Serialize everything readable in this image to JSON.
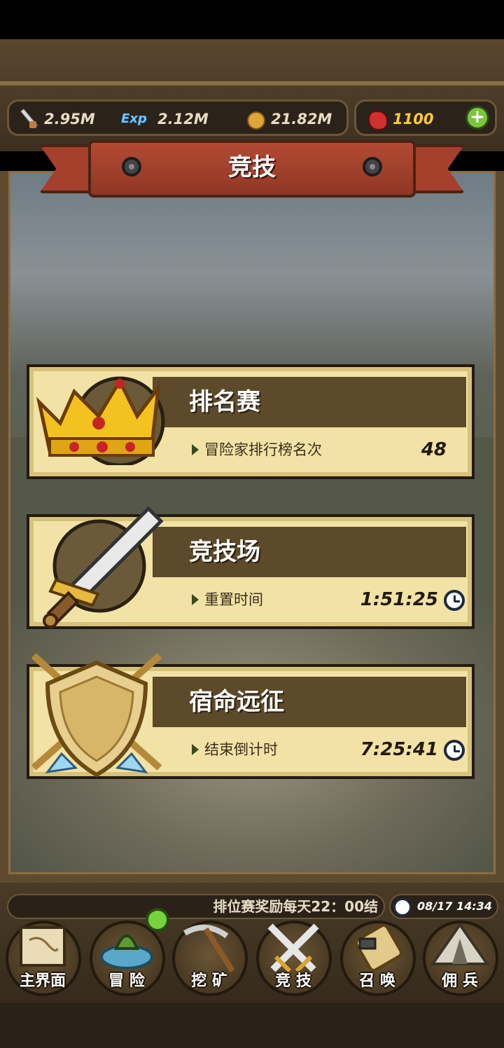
{
  "resources": {
    "attack": "2.95M",
    "exp_label": "Exp",
    "exp": "2.12M",
    "gold": "21.82M",
    "gems": "1100"
  },
  "title": "竞技",
  "cards": [
    {
      "title": "排名赛",
      "sub": "冒险家排行榜名次",
      "value": "48",
      "icon": "crown-icon"
    },
    {
      "title": "竞技场",
      "sub": "重置时间",
      "value": "1:51:25",
      "icon": "sword-icon"
    },
    {
      "title": "宿命远征",
      "sub": "结束倒计时",
      "value": "7:25:41",
      "icon": "shield-icon"
    }
  ],
  "ticker": "排位赛奖励每天22：00结",
  "datetime": "08/17 14:34",
  "nav": [
    {
      "label": "主界面",
      "icon": "map-scroll-icon"
    },
    {
      "label": "冒 险",
      "icon": "island-icon"
    },
    {
      "label": "挖 矿",
      "icon": "pickaxe-icon"
    },
    {
      "label": "竞 技",
      "icon": "crossed-swords-icon"
    },
    {
      "label": "召 唤",
      "icon": "summon-scroll-icon"
    },
    {
      "label": "佣 兵",
      "icon": "tent-icon"
    }
  ],
  "colors": {
    "accent_red": "#a4402c",
    "gem_yellow": "#ffcc2e",
    "card_bg": "#f2e2a6",
    "card_head": "#5c4a2a",
    "badge_green": "#76d43a"
  }
}
